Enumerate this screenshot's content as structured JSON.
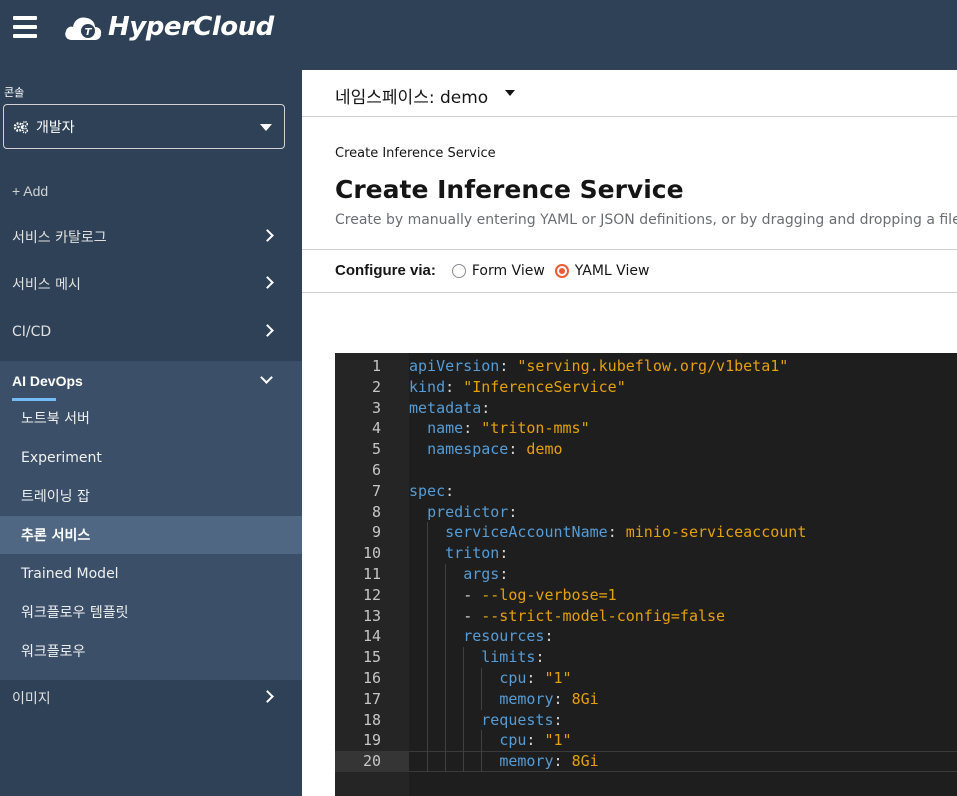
{
  "masthead": {
    "brand": "HyperCloud"
  },
  "sidebar": {
    "perspective_label": "콘솔",
    "perspective_value": "개발자",
    "add_label": "+ Add",
    "items": [
      {
        "label": "서비스 카탈로그"
      },
      {
        "label": "서비스 메시"
      },
      {
        "label": "CI/CD"
      }
    ],
    "section": {
      "title": "AI DevOps",
      "items": [
        {
          "label": "노트북 서버"
        },
        {
          "label": "Experiment"
        },
        {
          "label": "트레이닝 잡"
        },
        {
          "label": "추론 서비스"
        },
        {
          "label": "Trained Model"
        },
        {
          "label": "워크플로우 템플릿"
        },
        {
          "label": "워크플로우"
        }
      ],
      "active_index": 3
    },
    "after_items": [
      {
        "label": "이미지"
      }
    ]
  },
  "namespace": {
    "label": "네임스페이스: demo"
  },
  "page": {
    "breadcrumb": "Create Inference Service",
    "title": "Create Inference Service",
    "description": "Create by manually entering YAML or JSON definitions, or by dragging and dropping a file into the editor.",
    "configure_label": "Configure via:",
    "options": [
      "Form View",
      "YAML View"
    ],
    "selected_option": "YAML View"
  },
  "editor": {
    "current_line": 20,
    "lines": [
      {
        "n": "1",
        "indent": "",
        "key": "apiVersion",
        "sep": ": ",
        "val": "\"serving.kubeflow.org/v1beta1\"",
        "type": "s"
      },
      {
        "n": "2",
        "indent": "",
        "key": "kind",
        "sep": ": ",
        "val": "\"InferenceService\"",
        "type": "s"
      },
      {
        "n": "3",
        "indent": "",
        "key": "metadata",
        "sep": ":",
        "val": "",
        "type": ""
      },
      {
        "n": "4",
        "indent": "  ",
        "key": "name",
        "sep": ": ",
        "val": "\"triton-mms\"",
        "type": "s"
      },
      {
        "n": "5",
        "indent": "  ",
        "key": "namespace",
        "sep": ": ",
        "val": "demo",
        "type": "v"
      },
      {
        "n": "6",
        "indent": "",
        "key": "",
        "sep": "",
        "val": "",
        "type": ""
      },
      {
        "n": "7",
        "indent": "",
        "key": "spec",
        "sep": ":",
        "val": "",
        "type": ""
      },
      {
        "n": "8",
        "indent": "  ",
        "key": "predictor",
        "sep": ":",
        "val": "",
        "type": ""
      },
      {
        "n": "9",
        "indent": "    ",
        "key": "serviceAccountName",
        "sep": ": ",
        "val": "minio-serviceaccount",
        "type": "v"
      },
      {
        "n": "10",
        "indent": "    ",
        "key": "triton",
        "sep": ":",
        "val": "",
        "type": ""
      },
      {
        "n": "11",
        "indent": "      ",
        "key": "args",
        "sep": ":",
        "val": "",
        "type": ""
      },
      {
        "n": "12",
        "indent": "      ",
        "key": "",
        "sep": "- ",
        "val": "--log-verbose=1",
        "type": "v"
      },
      {
        "n": "13",
        "indent": "      ",
        "key": "",
        "sep": "- ",
        "val": "--strict-model-config=false",
        "type": "v"
      },
      {
        "n": "14",
        "indent": "      ",
        "key": "resources",
        "sep": ":",
        "val": "",
        "type": ""
      },
      {
        "n": "15",
        "indent": "        ",
        "key": "limits",
        "sep": ":",
        "val": "",
        "type": ""
      },
      {
        "n": "16",
        "indent": "          ",
        "key": "cpu",
        "sep": ": ",
        "val": "\"1\"",
        "type": "s"
      },
      {
        "n": "17",
        "indent": "          ",
        "key": "memory",
        "sep": ": ",
        "val": "8Gi",
        "type": "v"
      },
      {
        "n": "18",
        "indent": "        ",
        "key": "requests",
        "sep": ":",
        "val": "",
        "type": ""
      },
      {
        "n": "19",
        "indent": "          ",
        "key": "cpu",
        "sep": ": ",
        "val": "\"1\"",
        "type": "s"
      },
      {
        "n": "20",
        "indent": "          ",
        "key": "memory",
        "sep": ": ",
        "val": "8Gi",
        "type": "v"
      }
    ]
  }
}
